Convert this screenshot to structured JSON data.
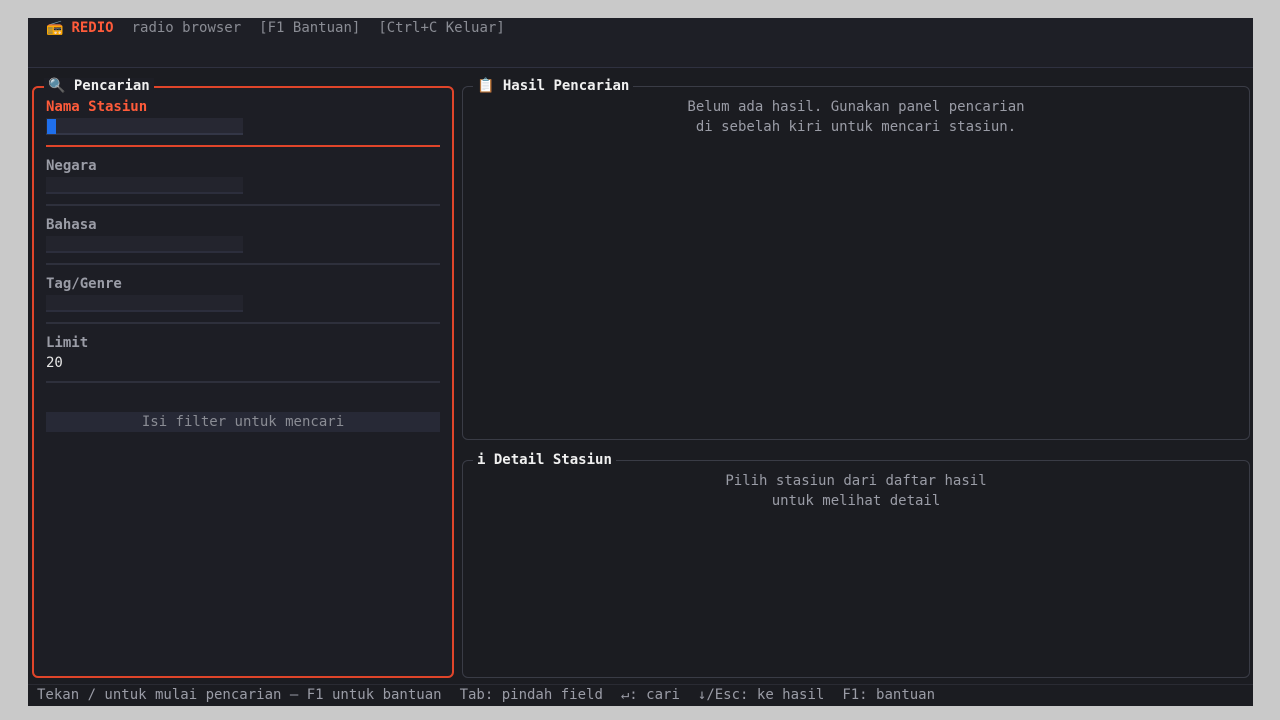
{
  "topbar": {
    "icon": "radio-icon",
    "brand": "REDIO",
    "subtitle": "radio browser",
    "help_hint": "[F1 Bantuan]",
    "exit_hint": "[Ctrl+C Keluar]"
  },
  "search_panel": {
    "title": "Pencarian",
    "icon": "magnifier-icon",
    "fields": [
      {
        "label": "Nama Stasiun",
        "value": ""
      },
      {
        "label": "Negara",
        "value": ""
      },
      {
        "label": "Bahasa",
        "value": ""
      },
      {
        "label": "Tag/Genre",
        "value": ""
      },
      {
        "label": "Limit",
        "value": "20"
      }
    ],
    "search_button": "Isi filter untuk mencari"
  },
  "results_panel": {
    "title": "Hasil Pencarian",
    "icon": "clipboard-icon",
    "empty_line1": "Belum ada hasil. Gunakan panel pencarian",
    "empty_line2": "di sebelah kiri untuk mencari stasiun."
  },
  "detail_panel": {
    "title": "Detail Stasiun",
    "icon": "info-icon",
    "empty_line1": "Pilih stasiun dari daftar hasil",
    "empty_line2": "untuk melihat detail"
  },
  "statusbar": {
    "hint": "Tekan / untuk mulai pencarian — F1 untuk bantuan",
    "tab": "Tab: pindah field",
    "enter": "↵: cari",
    "down": "↓/Esc: ke hasil",
    "f1": "F1: bantuan"
  },
  "colors": {
    "accent": "#e0452a",
    "cursor": "#1f6feb",
    "background": "#1b1c21"
  }
}
